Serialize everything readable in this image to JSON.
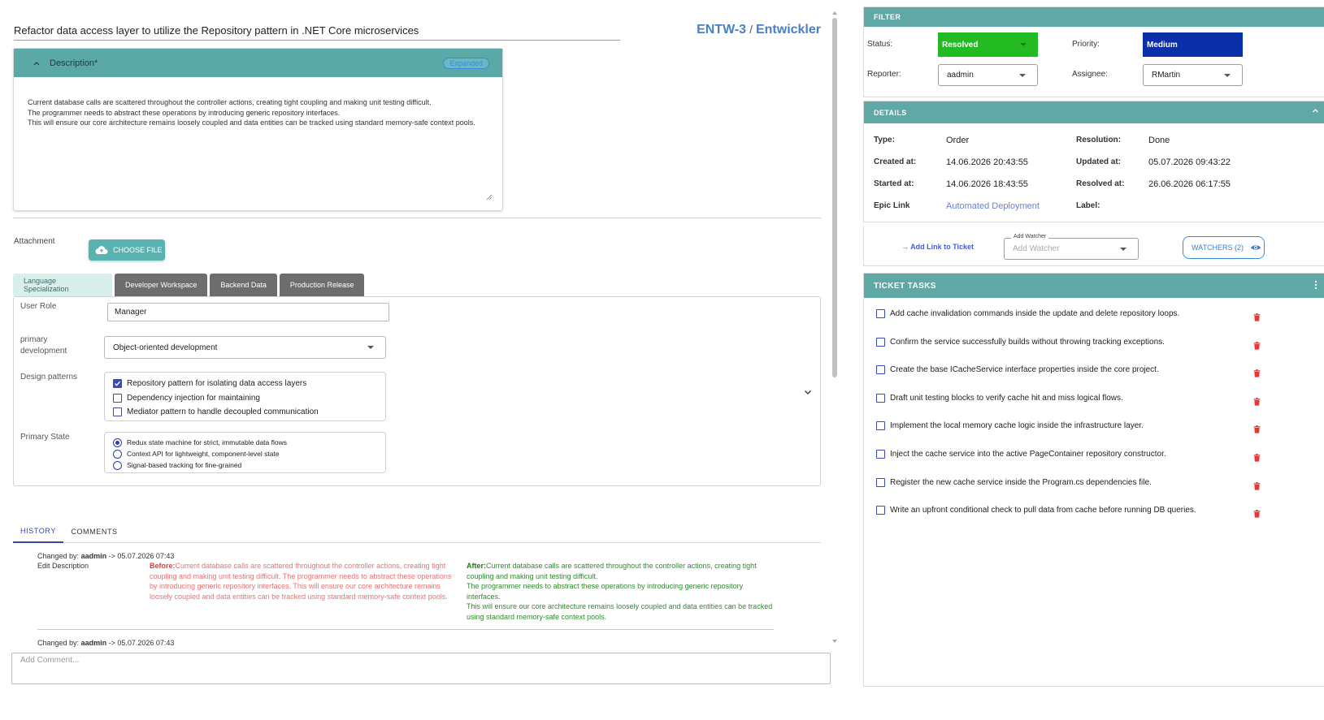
{
  "ticket": {
    "title": "Refactor data access layer to utilize the Repository pattern in .NET Core microservices",
    "project_key": "ENTW-3",
    "project_sep": "/",
    "project_name": "Entwickler"
  },
  "description": {
    "header": "Description*",
    "badge": "Expanded",
    "lines": [
      "Current database calls are scattered throughout the controller actions, creating tight coupling and making unit testing difficult.",
      "The programmer needs to abstract these operations by introducing generic repository interfaces.",
      "This will ensure our core architecture remains loosely coupled and data entities can be tracked using standard memory-safe context pools."
    ]
  },
  "attachment": {
    "label": "Attachment",
    "button": "CHOOSE FILE"
  },
  "tabs": [
    "Language Specialization",
    "Developer Workspace",
    "Backend Data",
    "Production Release"
  ],
  "form": {
    "user_role_label": "User Role",
    "user_role_value": "Manager",
    "primary_dev_label_1": "primary",
    "primary_dev_label_2": "development",
    "primary_dev_value": "Object-oriented development",
    "design_patterns_label": "Design patterns",
    "design_patterns": [
      {
        "label": "Repository pattern for isolating data access layers",
        "checked": true
      },
      {
        "label": "Dependency injection for maintaining",
        "checked": false
      },
      {
        "label": "Mediator pattern to handle decoupled communication",
        "checked": false
      }
    ],
    "primary_state_label": "Primary State",
    "primary_state": [
      {
        "label": "Redux state machine for strict, immutable data flows",
        "selected": true
      },
      {
        "label": "Context API for lightweight, component-level state",
        "selected": false
      },
      {
        "label": "Signal-based tracking for fine-grained",
        "selected": false
      }
    ]
  },
  "history": {
    "tab_history": "HISTORY",
    "tab_comments": "COMMENTS",
    "changed_by_label": "Changed by:",
    "entry1_user": "aadmin",
    "entry1_time": "-> 05.07.2026 07:43",
    "entry1_action": "Edit Description",
    "before_label": "Before:",
    "before_text": "Current database calls are scattered throughout the controller actions, creating tight coupling and making unit testing difficult. The programmer needs to abstract these operations by introducing generic repository interfaces. This will ensure our core architecture remains loosely coupled and data entities can be tracked using standard memory-safe context pools.",
    "after_label": "After:",
    "after_lines": [
      "Current database calls are scattered throughout the controller actions, creating tight coupling and making unit testing difficult.",
      "The programmer needs to abstract these operations by introducing generic repository interfaces.",
      "This will ensure our core architecture remains loosely coupled and data entities can be tracked using standard memory-safe context pools."
    ],
    "entry2_user": "aadmin",
    "entry2_time": "-> 05.07.2026 07:43"
  },
  "comment": {
    "placeholder": "Add Comment..."
  },
  "filter": {
    "header": "FILTER",
    "status_label": "Status:",
    "status_value": "Resolved",
    "status_color": "#22bb22",
    "priority_label": "Priority:",
    "priority_value": "Medium",
    "priority_color": "#0a2fa8",
    "reporter_label": "Reporter:",
    "reporter_value": "aadmin",
    "assignee_label": "Assignee:",
    "assignee_value": "RMartin"
  },
  "details": {
    "header": "DETAILS",
    "type_label": "Type:",
    "type_value": "Order",
    "resolution_label": "Resolution:",
    "resolution_value": "Done",
    "created_label": "Created at:",
    "created_value": "14.06.2026 20:43:55",
    "updated_label": "Updated at:",
    "updated_value": "05.07.2026 09:43:22",
    "started_label": "Started at:",
    "started_value": "14.06.2026 18:43:55",
    "resolved_label": "Resolved at:",
    "resolved_value": "26.06.2026 06:17:55",
    "epic_label": "Epic Link",
    "epic_value": "Automated Deployment",
    "label_label": "Label:"
  },
  "links": {
    "add_link": "→ Add Link to Ticket",
    "add_watcher_legend": "Add Watcher",
    "add_watcher_placeholder": "Add Watcher",
    "watchers_button": "WATCHERS (2)"
  },
  "tasks": {
    "header": "TICKET TASKS",
    "items": [
      "Add cache invalidation commands inside the update and delete repository loops.",
      "Confirm the service successfully builds without throwing tracking exceptions.",
      "Create the base ICacheService interface properties inside the core project.",
      "Draft unit testing blocks to verify cache hit and miss logical flows.",
      "Implement the local memory cache logic inside the infrastructure layer.",
      "Inject the cache service into the active PageContainer repository constructor.",
      "Register the new cache service inside the Program.cs dependencies file.",
      "Write an upfront conditional check to pull data from cache before running DB queries."
    ]
  }
}
